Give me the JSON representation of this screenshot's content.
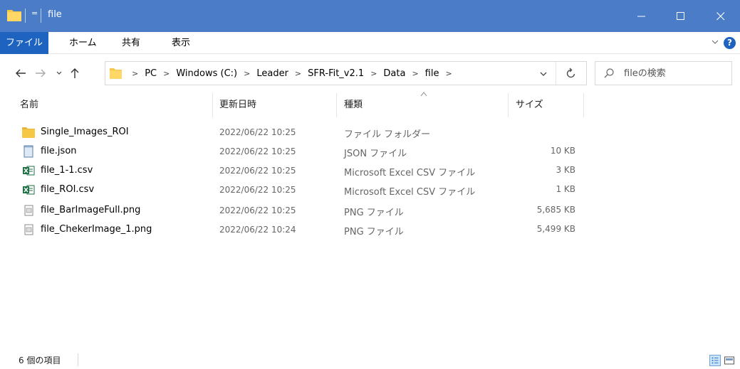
{
  "window": {
    "title": "file",
    "qa_toolbar_glyph": "="
  },
  "ribbon": {
    "tabs": [
      {
        "label": "ファイル"
      },
      {
        "label": "ホーム"
      },
      {
        "label": "共有"
      },
      {
        "label": "表示"
      }
    ],
    "help_label": "?"
  },
  "nav": {
    "breadcrumbs": [
      "PC",
      "Windows (C:)",
      "Leader",
      "SFR-Fit_v2.1",
      "Data",
      "file"
    ],
    "search_placeholder": "fileの検索"
  },
  "columns": {
    "name": "名前",
    "date": "更新日時",
    "type": "種類",
    "size": "サイズ"
  },
  "files": [
    {
      "name": "Single_Images_ROI",
      "date": "2022/06/22 10:25",
      "type": "ファイル フォルダー",
      "size": "",
      "icon": "folder-icon"
    },
    {
      "name": "file.json",
      "date": "2022/06/22 10:25",
      "type": "JSON ファイル",
      "size": "10 KB",
      "icon": "json-file-icon"
    },
    {
      "name": "file_1-1.csv",
      "date": "2022/06/22 10:25",
      "type": "Microsoft Excel CSV ファイル",
      "size": "3 KB",
      "icon": "excel-csv-icon"
    },
    {
      "name": "file_ROI.csv",
      "date": "2022/06/22 10:25",
      "type": "Microsoft Excel CSV ファイル",
      "size": "1 KB",
      "icon": "excel-csv-icon"
    },
    {
      "name": "file_BarImageFull.png",
      "date": "2022/06/22 10:25",
      "type": "PNG ファイル",
      "size": "5,685 KB",
      "icon": "png-file-icon"
    },
    {
      "name": "file_ChekerImage_1.png",
      "date": "2022/06/22 10:24",
      "type": "PNG ファイル",
      "size": "5,499 KB",
      "icon": "png-file-icon"
    }
  ],
  "status": {
    "item_count": "6 個の項目"
  },
  "colors": {
    "title_bar": "#4a7cc7",
    "file_tab": "#1e63c0",
    "folder": "#f6c744",
    "excel": "#1d7044"
  }
}
